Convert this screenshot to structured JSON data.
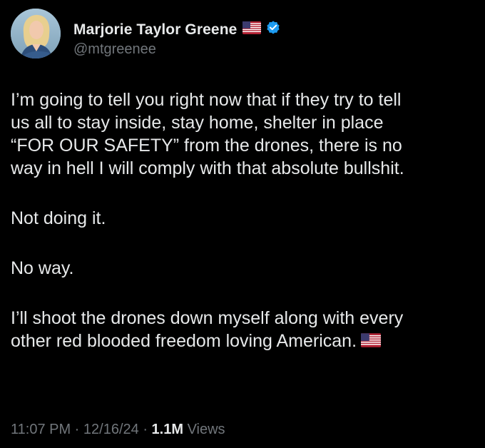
{
  "author": {
    "name": "Marjorie Taylor Greene",
    "handle": "@mtgreenee",
    "name_emoji": "us-flag-icon",
    "badge": "verified-icon",
    "badge_color": "#1d9bf0"
  },
  "tweet": {
    "paragraphs": [
      "I’m going to tell you right now that if they try to tell\nus all to stay inside, stay home, shelter in place\n“FOR OUR SAFETY” from the drones, there is no\nway in hell I will comply with that absolute bullshit.",
      "Not doing it.",
      "No way.",
      "I’ll shoot the drones down myself along with every\nother red blooded freedom loving American."
    ],
    "trailing_emoji": "us-flag-icon"
  },
  "meta": {
    "time": "11:07 PM",
    "sep1": " · ",
    "date": "12/16/24",
    "sep2": " · ",
    "views_count": "1.1M",
    "views_label": " Views"
  },
  "colors": {
    "background": "#000000",
    "text": "#e7e9ea",
    "secondary": "#71767b"
  }
}
